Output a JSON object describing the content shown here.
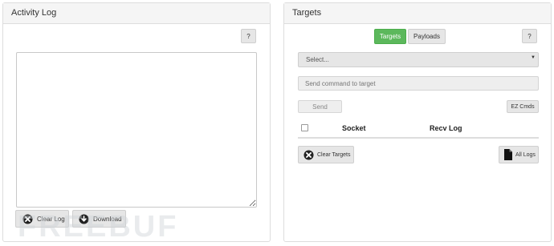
{
  "activity_log": {
    "title": "Activity Log",
    "help_label": "?",
    "log_text": "",
    "clear_label": "Clear Log",
    "download_label": "Download"
  },
  "targets": {
    "title": "Targets",
    "tabs": [
      {
        "label": "Targets",
        "active": true
      },
      {
        "label": "Payloads",
        "active": false
      }
    ],
    "help_label": "?",
    "select_value": "Select...",
    "command_placeholder": "Send command to target",
    "send_label": "Send",
    "ez_cmds_label": "EZ Cmds",
    "table": {
      "columns": [
        "Socket",
        "Recv Log"
      ]
    },
    "clear_targets_label": "Clear Targets",
    "all_logs_label": "All Logs"
  },
  "watermark": "FREEBUF",
  "colors": {
    "success": "#5cb85c",
    "panel_heading": "#f5f5f5",
    "border": "#dddddd"
  }
}
